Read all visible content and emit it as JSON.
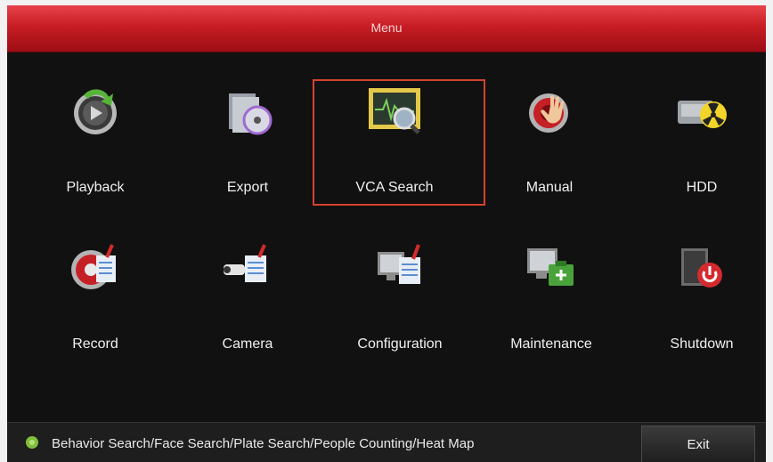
{
  "window": {
    "title": "Menu"
  },
  "menu": {
    "items": [
      {
        "label": "Playback",
        "icon": "playback-icon"
      },
      {
        "label": "Export",
        "icon": "export-icon"
      },
      {
        "label": "VCA Search",
        "icon": "vca-search-icon",
        "selected": true
      },
      {
        "label": "Manual",
        "icon": "manual-icon"
      },
      {
        "label": "HDD",
        "icon": "hdd-icon"
      },
      {
        "label": "Record",
        "icon": "record-icon"
      },
      {
        "label": "Camera",
        "icon": "camera-icon"
      },
      {
        "label": "Configuration",
        "icon": "configuration-icon"
      },
      {
        "label": "Maintenance",
        "icon": "maintenance-icon"
      },
      {
        "label": "Shutdown",
        "icon": "shutdown-icon"
      }
    ]
  },
  "footer": {
    "hint": "Behavior Search/Face Search/Plate Search/People Counting/Heat Map",
    "hint_icon": "info-icon",
    "exit_label": "Exit"
  },
  "colors": {
    "title_bar": "#c81d24",
    "selection_border": "#d5432e",
    "background": "#0c0c0c"
  }
}
